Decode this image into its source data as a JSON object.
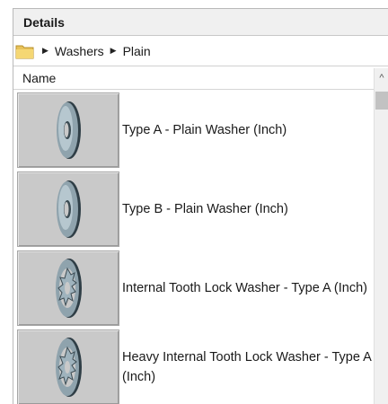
{
  "header": {
    "title": "Details"
  },
  "breadcrumb": {
    "items": [
      "Washers",
      "Plain"
    ],
    "root_icon": "folder-icon",
    "separator_icon": "triangle-right-icon"
  },
  "columns": {
    "name": "Name"
  },
  "items": [
    {
      "label": "Type A - Plain Washer (Inch)",
      "icon": "plain-washer-icon"
    },
    {
      "label": "Type B - Plain Washer (Inch)",
      "icon": "plain-washer-icon"
    },
    {
      "label": "Internal Tooth Lock Washer - Type A (Inch)",
      "icon": "tooth-lock-washer-icon"
    },
    {
      "label": "Heavy Internal Tooth Lock Washer - Type A (Inch)",
      "icon": "tooth-lock-washer-icon"
    }
  ],
  "scrollbar": {
    "up_icon": "scroll-up-arrow-icon"
  }
}
